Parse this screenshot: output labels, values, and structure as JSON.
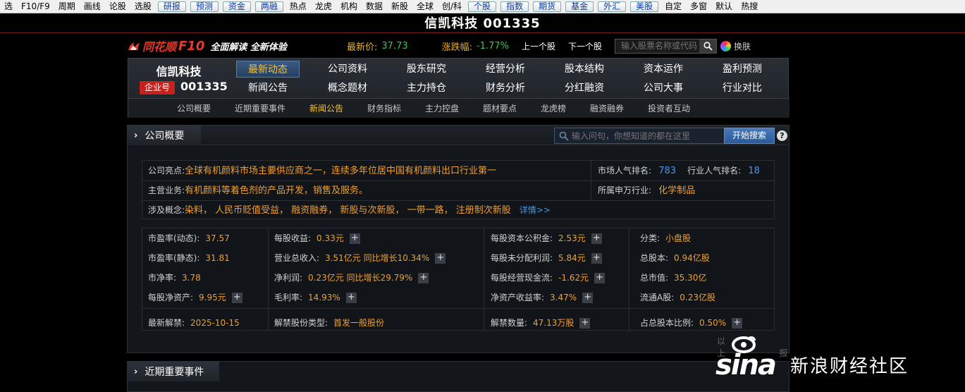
{
  "menubar": {
    "items": [
      {
        "label": "选",
        "btn": false
      },
      {
        "label": "F10/F9",
        "btn": false
      },
      {
        "label": "周期",
        "btn": false
      },
      {
        "label": "画线",
        "btn": false
      },
      {
        "label": "论股",
        "btn": false
      },
      {
        "label": "选股",
        "btn": false
      },
      {
        "label": "研报",
        "btn": true
      },
      {
        "label": "预测",
        "btn": true
      },
      {
        "label": "资金",
        "btn": true
      },
      {
        "label": "两融",
        "btn": true
      },
      {
        "label": "热点",
        "btn": false
      },
      {
        "label": "龙虎",
        "btn": false
      },
      {
        "label": "机构",
        "btn": false
      },
      {
        "label": "数据",
        "btn": false
      },
      {
        "label": "新股",
        "btn": false
      },
      {
        "label": "全球",
        "btn": false
      },
      {
        "label": "创/科",
        "btn": false
      },
      {
        "label": "个股",
        "btn": true
      },
      {
        "label": "指数",
        "btn": true
      },
      {
        "label": "期货",
        "btn": true
      },
      {
        "label": "基金",
        "btn": true
      },
      {
        "label": "外汇",
        "btn": true
      },
      {
        "label": "美股",
        "btn": true
      },
      {
        "label": "自定",
        "btn": false
      },
      {
        "label": "多窗",
        "btn": false
      },
      {
        "label": "默认",
        "btn": false
      },
      {
        "label": "热搜",
        "btn": false
      }
    ]
  },
  "title": "信凯科技 001335",
  "header": {
    "brand": "同花顺",
    "f10": "F10",
    "slogan": "全面解读 全新体验",
    "price_label": "最新价:",
    "price_value": "37.73",
    "change_label": "涨跌幅:",
    "change_value": "-1.77%",
    "prev_stock": "上一个股",
    "next_stock": "下一个股",
    "search_placeholder": "输入股票名称或代码",
    "swap_label": "换肤",
    "colors": {
      "brand": "#e63a2a",
      "price": "#2ccb58",
      "label": "#e8b030"
    }
  },
  "stock": {
    "name": "信凯科技",
    "tag": "企业号",
    "code": "001335"
  },
  "main_tabs": [
    {
      "label": "最新动态",
      "active": true
    },
    {
      "label": "公司资料"
    },
    {
      "label": "股东研究"
    },
    {
      "label": "经营分析"
    },
    {
      "label": "股本结构"
    },
    {
      "label": "资本运作"
    },
    {
      "label": "盈利预测"
    },
    {
      "label": "新闻公告"
    },
    {
      "label": "概念题材"
    },
    {
      "label": "主力持仓"
    },
    {
      "label": "财务分析"
    },
    {
      "label": "分红融资"
    },
    {
      "label": "公司大事"
    },
    {
      "label": "行业对比"
    }
  ],
  "sub_tabs": [
    {
      "label": "公司概要"
    },
    {
      "label": "近期重要事件"
    },
    {
      "label": "新闻公告",
      "active": true
    },
    {
      "label": "财务指标"
    },
    {
      "label": "主力控盘"
    },
    {
      "label": "题材要点"
    },
    {
      "label": "龙虎榜"
    },
    {
      "label": "融资融券"
    },
    {
      "label": "投资者互动"
    }
  ],
  "overview": {
    "title": "公司概要",
    "search_placeholder": "输入问句，你想知道的都在这里",
    "search_button": "开始搜索",
    "highlight_label": "公司亮点:",
    "highlight": "全球有机颜料市场主要供应商之一，连续多年位居中国有机颜料出口行业第一",
    "business_label": "主营业务:",
    "business": "有机颜料等着色剂的产品开发，销售及服务。",
    "concepts_label": "涉及概念:",
    "concepts": "染料， 人民币贬值受益， 融资融券， 新股与次新股， 一带一路， 注册制次新股",
    "concepts_more": "详情>>",
    "popularity_label": "市场人气排名:",
    "popularity": "783",
    "industry_pop_label": "行业人气排名:",
    "industry_pop": "18",
    "industry_label": "所属申万行业:",
    "industry": "化学制品",
    "metrics": [
      {
        "k": "市盈率(动态):",
        "v": "37.57",
        "plus": false
      },
      {
        "k": "每股收益:",
        "v": "0.33元",
        "plus": true
      },
      {
        "k": "每股资本公积金:",
        "v": "2.53元",
        "plus": true
      },
      {
        "k": "分类:",
        "v": "小盘股",
        "plus": false
      },
      {
        "k": "市盈率(静态):",
        "v": "31.81",
        "plus": false
      },
      {
        "k": "营业总收入:",
        "v": "3.51亿元 同比增长10.34%",
        "plus": true
      },
      {
        "k": "每股未分配利润:",
        "v": "5.84元",
        "plus": true
      },
      {
        "k": "总股本:",
        "v": "0.94亿股",
        "plus": false
      },
      {
        "k": "市净率:",
        "v": "3.78",
        "plus": false
      },
      {
        "k": "净利润:",
        "v": "0.23亿元 同比增长29.79%",
        "plus": true
      },
      {
        "k": "每股经营现金流:",
        "v": "-1.62元",
        "plus": true
      },
      {
        "k": "总市值:",
        "v": "35.30亿",
        "plus": false
      },
      {
        "k": "每股净资产:",
        "v": "9.95元",
        "plus": true
      },
      {
        "k": "毛利率:",
        "v": "14.93%",
        "plus": true
      },
      {
        "k": "净资产收益率:",
        "v": "3.47%",
        "plus": true
      },
      {
        "k": "流通A股:",
        "v": "0.23亿股",
        "plus": false
      }
    ],
    "unlock": [
      {
        "k": "最新解禁:",
        "v": "2025-10-15",
        "plus": false
      },
      {
        "k": "解禁股份类型:",
        "v": "首发一般股份",
        "plus": false
      },
      {
        "k": "解禁数量:",
        "v": "47.13万股",
        "plus": true
      },
      {
        "k": "占总股本比例:",
        "v": "0.50%",
        "plus": true
      }
    ],
    "footnote": "以上",
    "footnote2": "报"
  },
  "events": {
    "title": "近期重要事件"
  },
  "watermark": {
    "logo": "sina",
    "text": "新浪财经社区"
  }
}
